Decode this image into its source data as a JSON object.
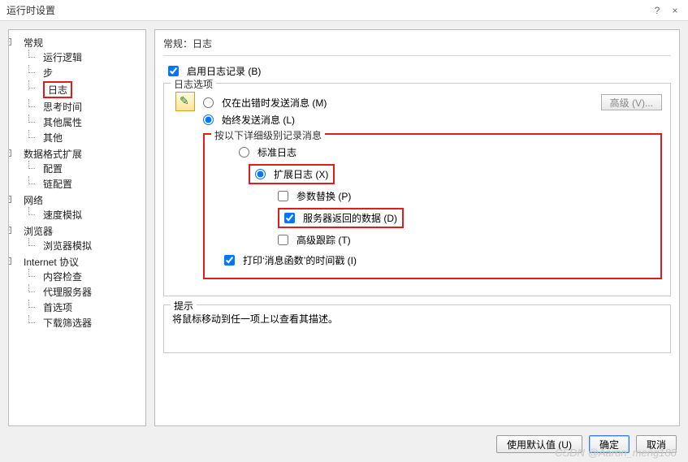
{
  "titlebar": {
    "title": "运行时设置",
    "help": "?",
    "close": "×"
  },
  "tree": {
    "g0": {
      "label": "常规",
      "c0": "运行逻辑",
      "c1": "步",
      "c2": "日志",
      "c3": "思考时间",
      "c4": "其他属性",
      "c5": "其他"
    },
    "g1": {
      "label": "数据格式扩展",
      "c0": "配置",
      "c1": "链配置"
    },
    "g2": {
      "label": "网络",
      "c0": "速度模拟"
    },
    "g3": {
      "label": "浏览器",
      "c0": "浏览器模拟"
    },
    "g4": {
      "label": "Internet 协议",
      "c0": "内容检查",
      "c1": "代理服务器",
      "c2": "首选项",
      "c3": "下载筛选器"
    }
  },
  "content": {
    "breadcrumb": "常规：日志",
    "enable_log": "启用日志记录 (B)",
    "options_legend": "日志选项",
    "only_on_error": "仅在出错时发送消息 (M)",
    "always_send": "始终发送消息 (L)",
    "advanced_btn": "高级 (V)...",
    "detail_legend": "按以下详细级别记录消息",
    "std_log": "标准日志",
    "ext_log": "扩展日志 (X)",
    "param_sub": "参数替换 (P)",
    "server_data": "服务器返回的数据 (D)",
    "adv_trace": "高级跟踪 (T)",
    "print_ts": "打印‘消息函数’的时间戳 (I)",
    "hint_legend": "提示",
    "hint_text": "将鼠标移动到任一项上以查看其描述。"
  },
  "footer": {
    "defaults": "使用默认值 (U)",
    "ok": "确定",
    "cancel": "取消"
  },
  "watermark": "CSDN @Aaron_meng188"
}
